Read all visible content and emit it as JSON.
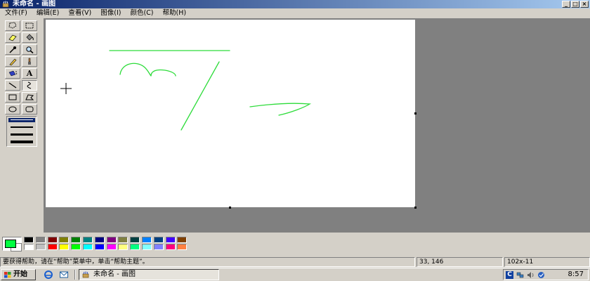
{
  "window": {
    "title": "未命名 - 画图",
    "controls": [
      "_",
      "□",
      "×"
    ]
  },
  "menu": [
    "文件(F)",
    "编辑(E)",
    "查看(V)",
    "图像(I)",
    "颜色(C)",
    "帮助(H)"
  ],
  "tools": {
    "text_tool_glyph": "A",
    "active_tool": "curve-tool"
  },
  "colors": {
    "foreground": "#00ff40",
    "background": "#ffffff",
    "drawing_stroke": "#2ddc3a",
    "palette": [
      "#000000",
      "#808080",
      "#800000",
      "#808000",
      "#008000",
      "#008080",
      "#000080",
      "#800080",
      "#808040",
      "#004040",
      "#0080ff",
      "#004080",
      "#4000ff",
      "#804000",
      "#ffffff",
      "#c0c0c0",
      "#ff0000",
      "#ffff00",
      "#00ff00",
      "#00ffff",
      "#0000ff",
      "#ff00ff",
      "#ffff80",
      "#00ff80",
      "#80ffff",
      "#8080ff",
      "#ff0080",
      "#ff8040"
    ]
  },
  "statusbar": {
    "help_text": "要获得帮助，请在“帮助”菜单中，单击“帮助主题”。",
    "cursor_pos": "33, 146",
    "selection_size": "102x-11"
  },
  "taskbar": {
    "start_label": "开始",
    "task_label": "未命名 - 画图",
    "tray_lang": "C",
    "clock": "8:57"
  }
}
